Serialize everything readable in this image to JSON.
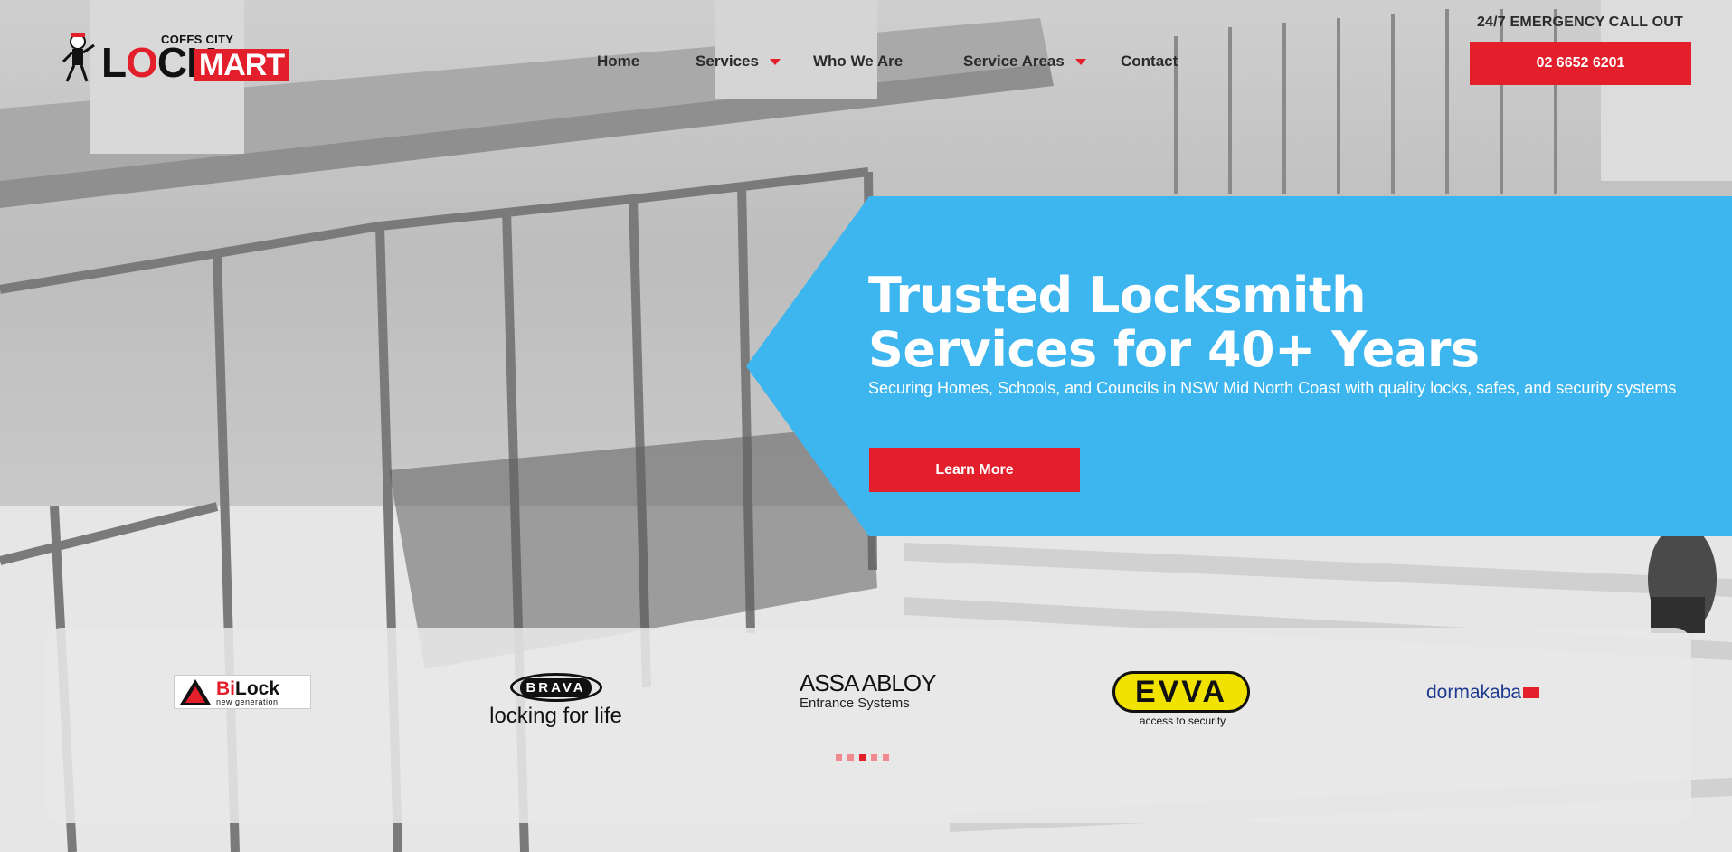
{
  "header": {
    "logo": {
      "top_text": "COFFS CITY",
      "main_text_a": "L",
      "main_text_o": "O",
      "main_text_b": "CK",
      "main_text_box": "MART"
    },
    "nav": [
      {
        "label": "Home",
        "dropdown": false
      },
      {
        "label": "Services",
        "dropdown": true
      },
      {
        "label": "Who We Are",
        "dropdown": false
      },
      {
        "label": "Service Areas",
        "dropdown": true
      },
      {
        "label": "Contact",
        "dropdown": false
      }
    ],
    "emergency_label": "24/7 EMERGENCY CALL OUT",
    "phone_button": "02 6652 6201"
  },
  "hero": {
    "title_line1": "Trusted Locksmith",
    "title_line2": "Services for 40+ Years",
    "subtitle": "Securing Homes, Schools, and Councils in NSW Mid North Coast with quality locks, safes, and security systems",
    "cta": "Learn More"
  },
  "brands": {
    "bilock": {
      "name_b": "Bi",
      "name": "Lock",
      "sub": "new generation"
    },
    "brava": {
      "badge": "BRAVA",
      "tagline": "locking for life"
    },
    "assa": {
      "name": "ASSA ABLOY",
      "sub": "Entrance Systems"
    },
    "evva": {
      "name": "EVVA",
      "tagline": "access to security"
    },
    "dormakaba": {
      "name": "dormakaba"
    },
    "carousel": {
      "count": 5,
      "active_index": 2
    }
  },
  "colors": {
    "accent_red": "#e31f2b",
    "hero_blue": "#3db5ef",
    "text_dark": "#2b2b2b"
  }
}
